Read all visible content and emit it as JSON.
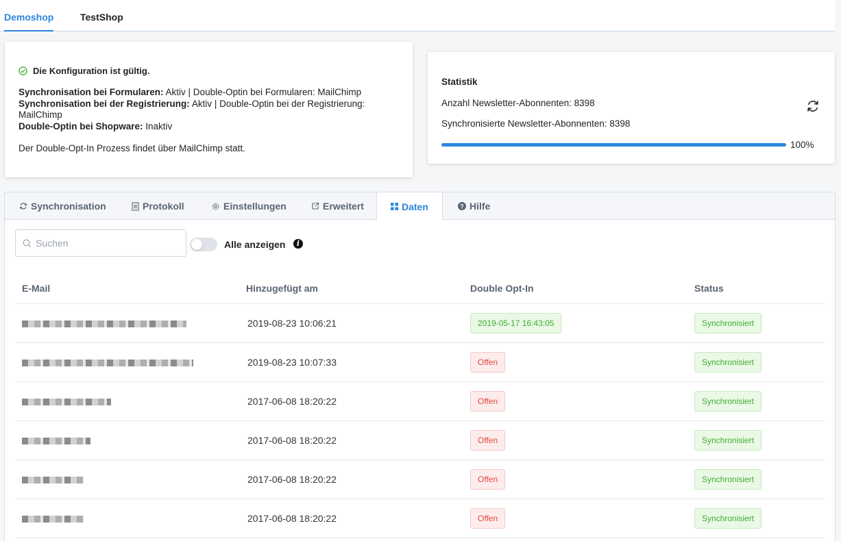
{
  "shop_tabs": [
    {
      "label": "Demoshop",
      "active": true
    },
    {
      "label": "TestShop",
      "active": false
    }
  ],
  "config": {
    "valid_text": "Die Konfiguration ist gültig.",
    "sync_forms_label": "Synchronisation bei Formularen:",
    "sync_forms_value": "Aktiv | Double-Optin bei Formularen: MailChimp",
    "sync_reg_label": "Synchronisation bei der Registrierung:",
    "sync_reg_value": "Aktiv | Double-Optin bei der Registrierung: MailChimp",
    "doi_shopware_label": "Double-Optin bei Shopware:",
    "doi_shopware_value": "Inaktiv",
    "note": "Der Double-Opt-In Prozess findet über MailChimp statt."
  },
  "stats": {
    "title": "Statistik",
    "subscribers": "Anzahl Newsletter-Abonnenten: 8398",
    "synced": "Synchronisierte Newsletter-Abonnenten: 8398",
    "progress_percent": 100,
    "progress_label": "100%"
  },
  "panel_tabs": [
    {
      "label": "Synchronisation",
      "icon": "sync-icon"
    },
    {
      "label": "Protokoll",
      "icon": "document-icon"
    },
    {
      "label": "Einstellungen",
      "icon": "gear-icon"
    },
    {
      "label": "Erweitert",
      "icon": "external-link-icon"
    },
    {
      "label": "Daten",
      "icon": "grid-icon",
      "active": true
    },
    {
      "label": "Hilfe",
      "icon": "help-icon"
    }
  ],
  "search": {
    "placeholder": "Suchen"
  },
  "toggle": {
    "label": "Alle anzeigen",
    "on": false
  },
  "table": {
    "headers": [
      "E-Mail",
      "Hinzugefügt am",
      "Double Opt-In",
      "Status"
    ],
    "rows": [
      {
        "added": "2019-08-23 10:06:21",
        "doi": "2019-05-17 16:43:05",
        "doi_type": "green",
        "status": "Synchronisiert"
      },
      {
        "added": "2019-08-23 10:07:33",
        "doi": "Offen",
        "doi_type": "red",
        "status": "Synchronisiert"
      },
      {
        "added": "2017-06-08 18:20:22",
        "doi": "Offen",
        "doi_type": "red",
        "status": "Synchronisiert"
      },
      {
        "added": "2017-06-08 18:20:22",
        "doi": "Offen",
        "doi_type": "red",
        "status": "Synchronisiert"
      },
      {
        "added": "2017-06-08 18:20:22",
        "doi": "Offen",
        "doi_type": "red",
        "status": "Synchronisiert"
      },
      {
        "added": "2017-06-08 18:20:22",
        "doi": "Offen",
        "doi_type": "red",
        "status": "Synchronisiert"
      }
    ]
  },
  "colors": {
    "accent": "#2b86dc",
    "success": "#3fae2f",
    "danger": "#e3483f"
  }
}
